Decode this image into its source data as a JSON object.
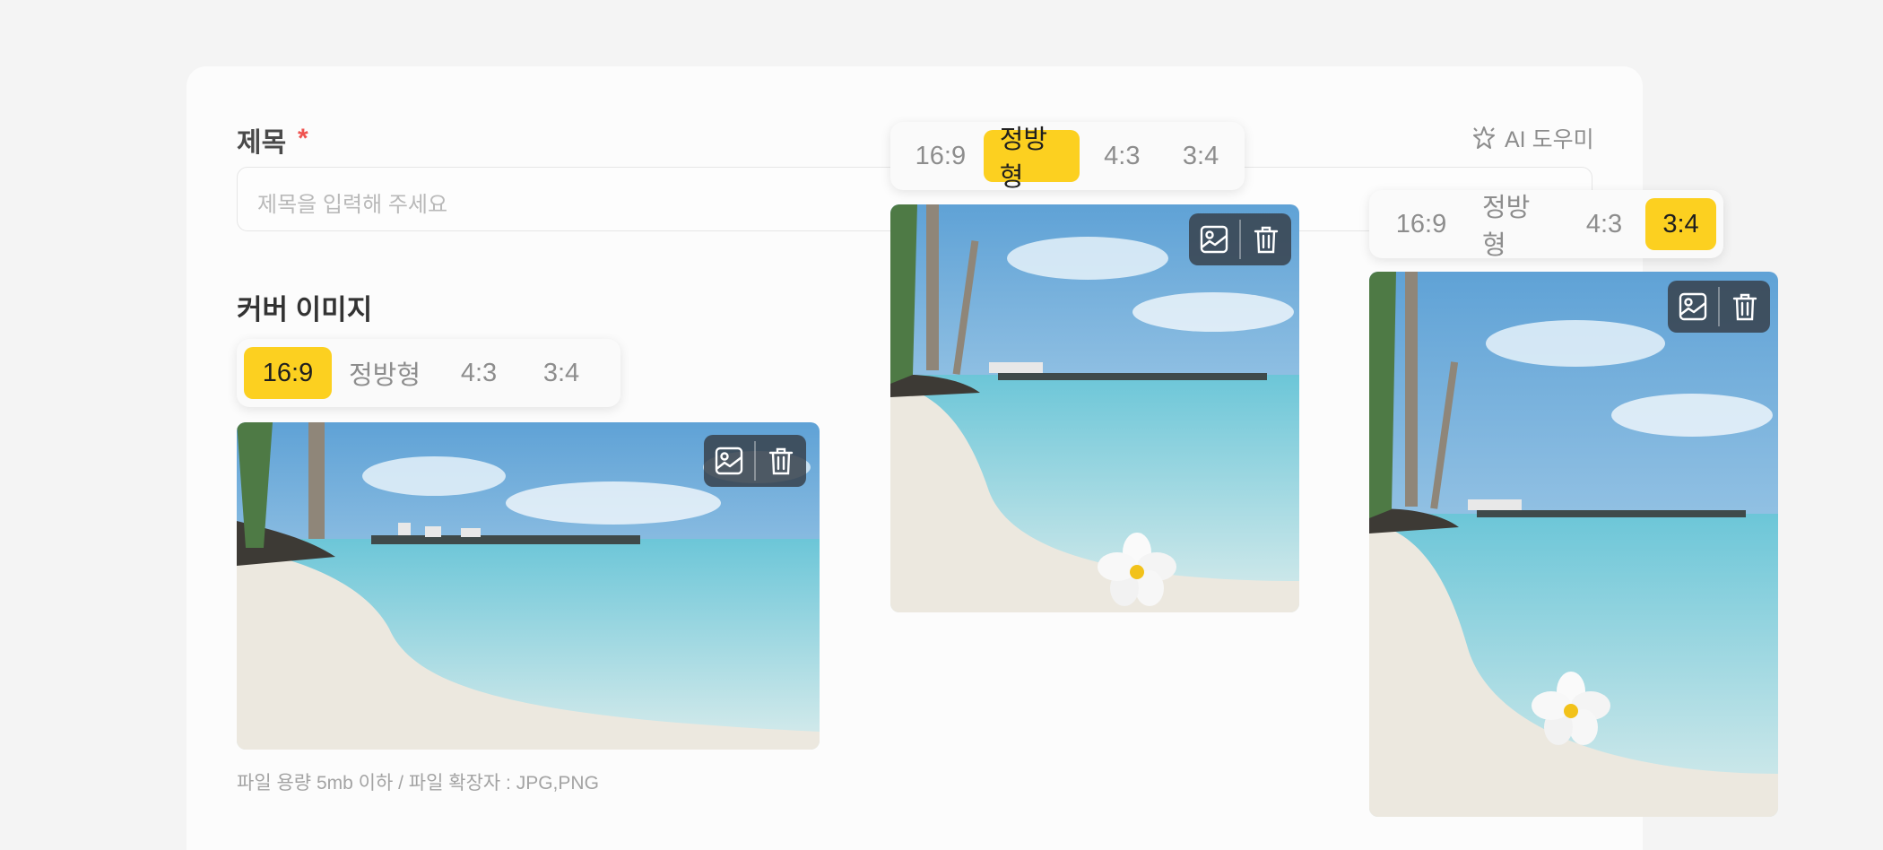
{
  "form": {
    "title_label": "제목",
    "required_mark": "*",
    "title_placeholder": "제목을 입력해 주세요",
    "ai_helper_label": "AI 도우미",
    "cover_label": "커버 이미지",
    "file_hint": "파일 용량 5mb 이하 / 파일 확장자 : JPG,PNG"
  },
  "ratio_options": [
    "16:9",
    "정방형",
    "4:3",
    "3:4"
  ],
  "previews": [
    {
      "selected_ratio": "16:9"
    },
    {
      "selected_ratio": "정방형"
    },
    {
      "selected_ratio": "3:4"
    }
  ],
  "icons": {
    "ai": "sparkle-icon",
    "change_image": "image-icon",
    "delete": "trash-icon"
  },
  "colors": {
    "accent": "#fcd020",
    "required": "#ef5350",
    "toolbar": "#37414b"
  }
}
